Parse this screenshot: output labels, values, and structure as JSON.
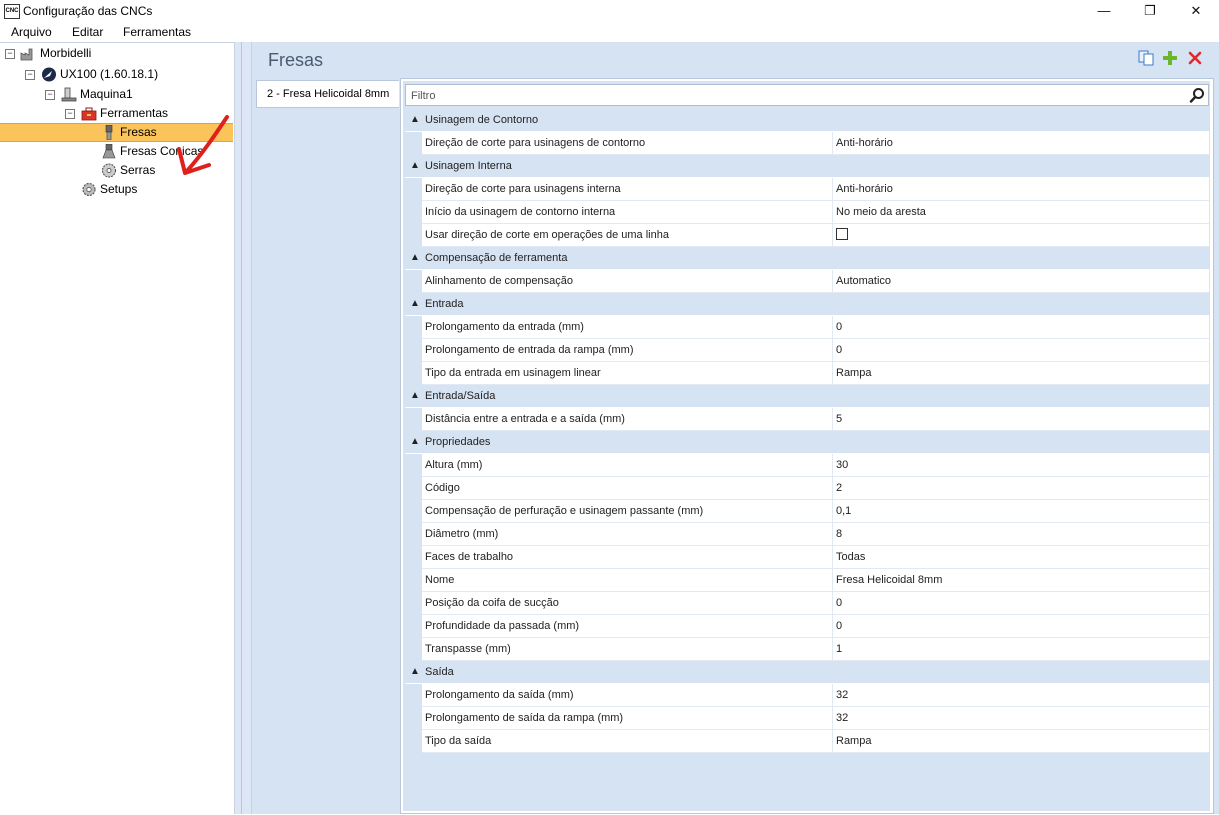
{
  "window": {
    "app_icon_text": "CNC",
    "title": "Configuração das CNCs",
    "minimize": "—",
    "maximize": "❐",
    "close": "✕"
  },
  "menu": [
    "Arquivo",
    "Editar",
    "Ferramentas"
  ],
  "tree": {
    "root": "Morbidelli",
    "machine_model": "UX100 (1.60.18.1)",
    "machine": "Maquina1",
    "tools": "Ferramentas",
    "mills": "Fresas",
    "conical_mills": "Fresas Conicas",
    "saws": "Serras",
    "setups": "Setups",
    "expander_minus": "−"
  },
  "panel": {
    "title": "Fresas",
    "tab": "2 - Fresa Helicoidal 8mm",
    "filter_placeholder": "Filtro"
  },
  "colors": {
    "selection": "#fbc45a",
    "panel_bg": "#d6e3f3",
    "add_icon": "#6cb52d",
    "delete_icon": "#e0282e"
  },
  "grid": {
    "chevron": "▲",
    "categories": [
      {
        "label": "Usinagem de Contorno",
        "rows": [
          {
            "name": "Direção de corte para usinagens de contorno",
            "value": "Anti-horário"
          }
        ]
      },
      {
        "label": "Usinagem Interna",
        "rows": [
          {
            "name": "Direção de corte para usinagens interna",
            "value": "Anti-horário"
          },
          {
            "name": "Início da usinagem de contorno interna",
            "value": "No meio da aresta"
          },
          {
            "name": "Usar direção de corte em operações de uma linha",
            "value": ""
          }
        ]
      },
      {
        "label": "Compensação de ferramenta",
        "rows": [
          {
            "name": "Alinhamento de compensação",
            "value": "Automatico"
          }
        ]
      },
      {
        "label": "Entrada",
        "rows": [
          {
            "name": "Prolongamento da entrada (mm)",
            "value": "0"
          },
          {
            "name": "Prolongamento de entrada da rampa (mm)",
            "value": "0"
          },
          {
            "name": "Tipo da entrada em usinagem linear",
            "value": "Rampa"
          }
        ]
      },
      {
        "label": "Entrada/Saída",
        "rows": [
          {
            "name": "Distância entre a entrada e a saída (mm)",
            "value": "5"
          }
        ]
      },
      {
        "label": "Propriedades",
        "rows": [
          {
            "name": "Altura (mm)",
            "value": "30"
          },
          {
            "name": "Código",
            "value": "2"
          },
          {
            "name": "Compensação de perfuração e usinagem passante (mm)",
            "value": "0,1"
          },
          {
            "name": "Diâmetro (mm)",
            "value": "8"
          },
          {
            "name": "Faces de trabalho",
            "value": "Todas"
          },
          {
            "name": "Nome",
            "value": "Fresa Helicoidal 8mm"
          },
          {
            "name": "Posição da coifa de sucção",
            "value": "0"
          },
          {
            "name": "Profundidade da passada (mm)",
            "value": "0"
          },
          {
            "name": "Transpasse (mm)",
            "value": "1"
          }
        ]
      },
      {
        "label": "Saída",
        "rows": [
          {
            "name": "Prolongamento da saída (mm)",
            "value": "32"
          },
          {
            "name": "Prolongamento de saída da rampa (mm)",
            "value": "32"
          },
          {
            "name": "Tipo da saída",
            "value": "Rampa"
          }
        ]
      }
    ]
  }
}
